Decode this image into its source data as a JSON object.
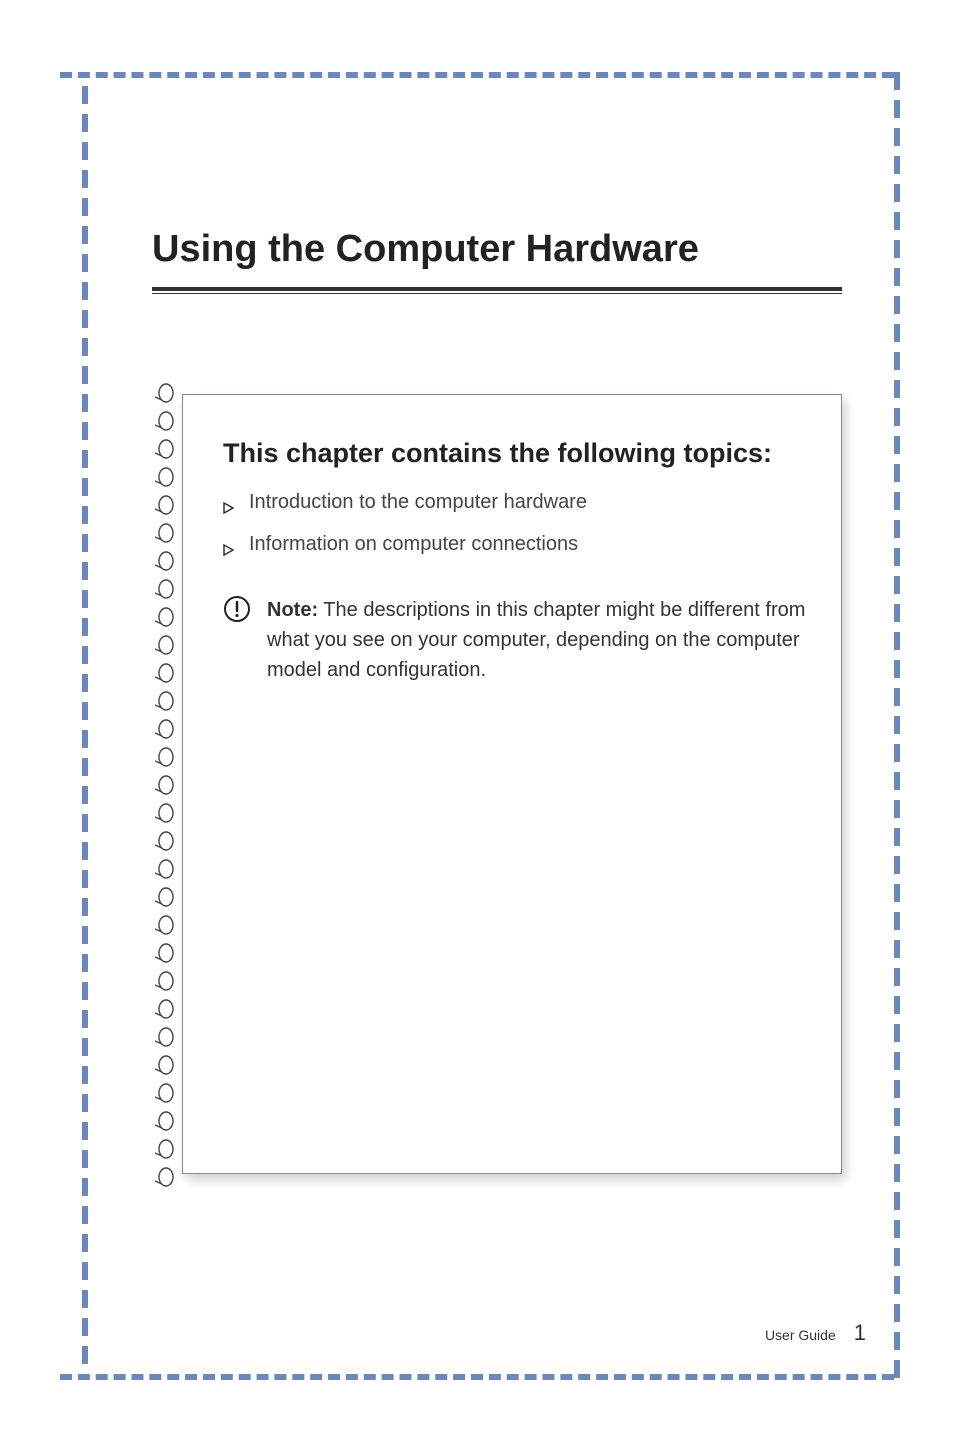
{
  "chapter": {
    "title": "Using the Computer Hardware"
  },
  "card": {
    "heading": "This chapter contains the following topics:",
    "topics": [
      "Introduction to the computer hardware",
      "Information on computer connections"
    ],
    "note": {
      "label": "Note:",
      "body": " The descriptions in this chapter might be different from what you see on your computer, depending on the computer model and configuration."
    }
  },
  "footer": {
    "label": "User Guide",
    "page": "1"
  }
}
